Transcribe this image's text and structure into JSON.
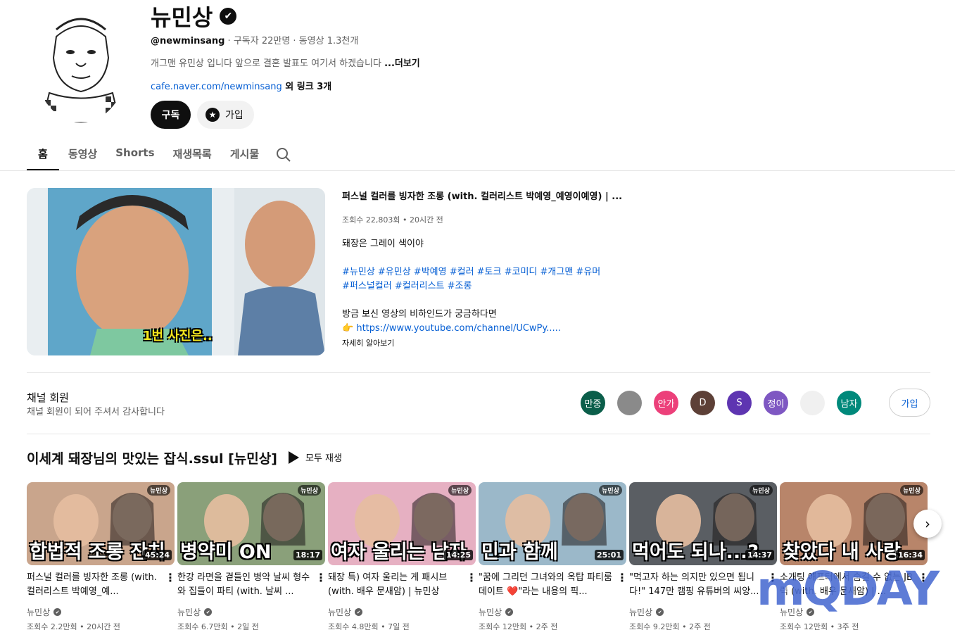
{
  "channel": {
    "name": "뉴민상",
    "verified_glyph": "✔",
    "handle": "@newminsang",
    "meta_rest": " · 구독자 22만명 · 동영상 1.3천개",
    "description": "개그맨 유민상 입니다 앞으로 결혼 발표도 여기서 하겠습니다 ",
    "description_more": "...더보기",
    "link_url": "cafe.naver.com/newminsang",
    "link_others": " 외 링크 3개",
    "subscribe_label": "구독",
    "join_label": "가입",
    "join_icon_glyph": "★"
  },
  "tabs": [
    {
      "label": "홈"
    },
    {
      "label": "동영상"
    },
    {
      "label": "Shorts"
    },
    {
      "label": "재생목록"
    },
    {
      "label": "게시물"
    }
  ],
  "featured": {
    "title": "퍼스널 컬러를 빙자한 조롱 (with. 컬러리스트 박예영_예영이예영) | ...",
    "stats": "조회수 22,803회 • 20시간 전",
    "desc_line1": "돼장은 그레이 색이야",
    "tags_line1": "#뉴민상 #유민상 #박예영 #컬러 #토크 #코미디 #개그맨 #유머",
    "tags_line2": "#퍼스널컬러 #컬러리스트 #조롱",
    "desc_line2": "방금 보신 영상의 비하인드가 궁금하다면",
    "pointer_glyph": "👉",
    "link": "https://www.youtube.com/channel/UCwPy.....",
    "more": "자세히 알아보기",
    "thumb_caption": "1번 사진은.."
  },
  "members": {
    "title": "채널 회원",
    "subtitle": "채널 회원이 되어 주셔서 감사합니다",
    "join_label": "가입",
    "avatars": [
      {
        "text": "만중",
        "color": "#0b5e4a"
      },
      {
        "text": "",
        "color": "#8a8a8a"
      },
      {
        "text": "안가",
        "color": "#ec407a"
      },
      {
        "text": "D",
        "color": "#5d4037"
      },
      {
        "text": "S",
        "color": "#5e35b1"
      },
      {
        "text": "정이",
        "color": "#7e57c2"
      },
      {
        "text": "",
        "color": "#f0f0f0"
      },
      {
        "text": "남자",
        "color": "#00897b"
      }
    ]
  },
  "playlist": {
    "title": "이세계 돼장님의 맛있는 잡식.ssul [뉴민상]",
    "play_all": "모두 재생",
    "next_glyph": "›",
    "videos": [
      {
        "thumb_logo": "뉴민상",
        "caption": "합법적 조롱 잔치",
        "duration": "45:24",
        "title": "퍼스널 컬러를 빙자한 조롱 (with. 컬러리스트 박예영_예...",
        "channel": "뉴민상",
        "stats": "조회수 2.2만회 • 20시간 전",
        "bg": "#c9a58c"
      },
      {
        "thumb_logo": "뉴민상",
        "caption": "병약미 ON",
        "duration": "18:17",
        "title": "한강 라면을 곁들인 병약 날씨 형수와 집들이 파티 (with. 날씨 ...",
        "channel": "뉴민상",
        "stats": "조회수 6.7만회 • 2일 전",
        "bg": "#8aa07a"
      },
      {
        "thumb_logo": "뉴민상",
        "caption": "여자 울리는 남자",
        "duration": "14:25",
        "title": "돼장 특) 여자 울리는 게 패시브 (with. 배우 문새암) | 뉴민상",
        "channel": "뉴민상",
        "stats": "조회수 4.8만회 • 7일 전",
        "bg": "#e6b0c2"
      },
      {
        "thumb_logo": "뉴민상",
        "caption": "민과 함께",
        "duration": "25:01",
        "title": "\"꿈에 그리던 그녀와의 옥탑 파티룸 데이트 ❤️\"라는 내용의 픽...",
        "channel": "뉴민상",
        "stats": "조회수 12만회 • 2주 전",
        "bg": "#9bb8c9"
      },
      {
        "thumb_logo": "뉴민상",
        "caption": "먹어도 되나...?",
        "duration": "14:37",
        "title": "\"먹고자 하는 의지만 있으면 됩니다!\" 147만 캠핑 유튜버의 씨양...",
        "channel": "뉴민상",
        "stats": "조회수 9.2만회 • 2주 전",
        "bg": "#5a5e63"
      },
      {
        "thumb_logo": "뉴민상",
        "caption": "찾았다 내 사랑",
        "duration": "16:34",
        "title": "소개팅 애프터에서 숨길 수 없는 JB력 (with. 배우 문새암) | ...",
        "channel": "뉴민상",
        "stats": "조회수 12만회 • 3주 전",
        "bg": "#b8856a"
      }
    ]
  },
  "watermark": "mQDAY"
}
